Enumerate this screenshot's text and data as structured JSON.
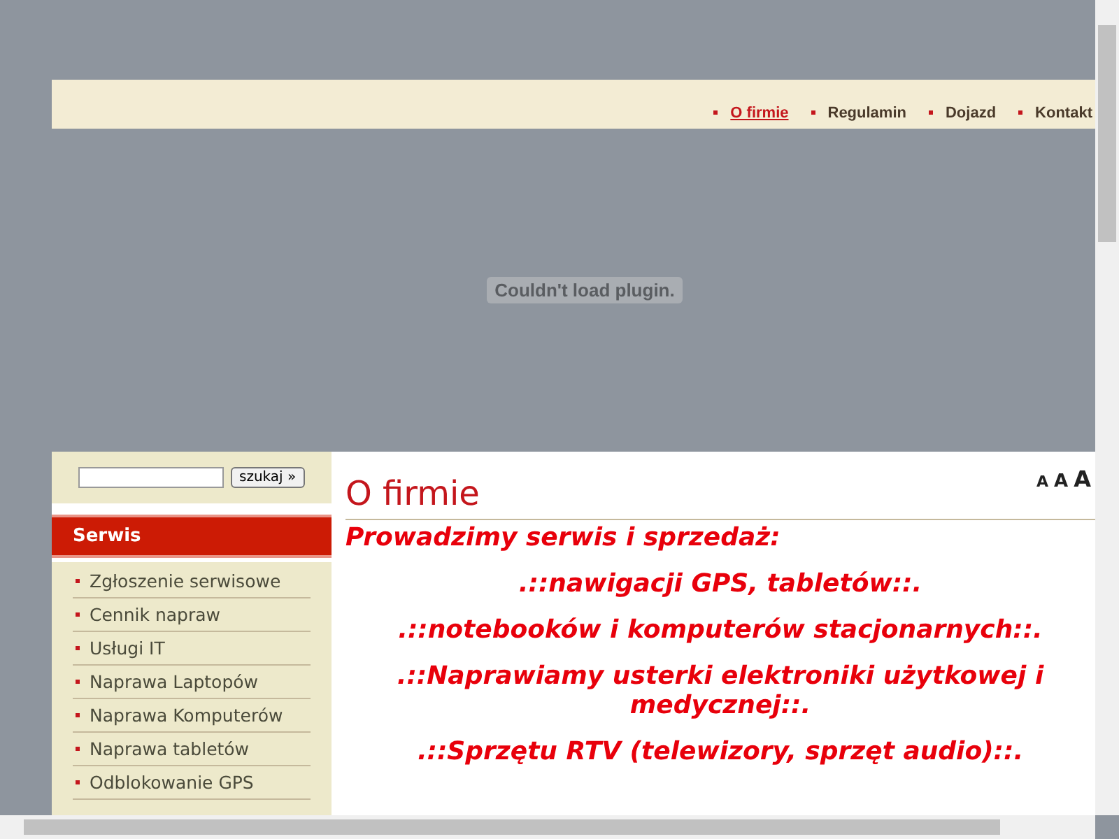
{
  "top_nav": [
    {
      "label": "O firmie",
      "selected": true
    },
    {
      "label": "Regulamin",
      "selected": false
    },
    {
      "label": "Dojazd",
      "selected": false
    },
    {
      "label": "Kontakt",
      "selected": false
    }
  ],
  "plugin_message": "Couldn't load plugin.",
  "search": {
    "button": "szukaj »"
  },
  "sidebar": {
    "heading": "Serwis",
    "items": [
      "Zgłoszenie serwisowe",
      "Cennik napraw",
      "Usługi IT",
      "Naprawa Laptopów",
      "Naprawa Komputerów",
      "Naprawa tabletów",
      "Odblokowanie GPS"
    ]
  },
  "font_sizes": [
    "A",
    "A",
    "A"
  ],
  "content": {
    "title": "O firmie",
    "intro": "Prowadzimy serwis i sprzedaż:",
    "lines": [
      ".::nawigacji GPS, tabletów::.",
      ".::notebooków i komputerów stacjonarnych::.",
      ".::Naprawiamy usterki elektroniki użytkowej i medycznej::.",
      ".::Sprzętu RTV (telewizory, sprzęt audio)::."
    ]
  }
}
